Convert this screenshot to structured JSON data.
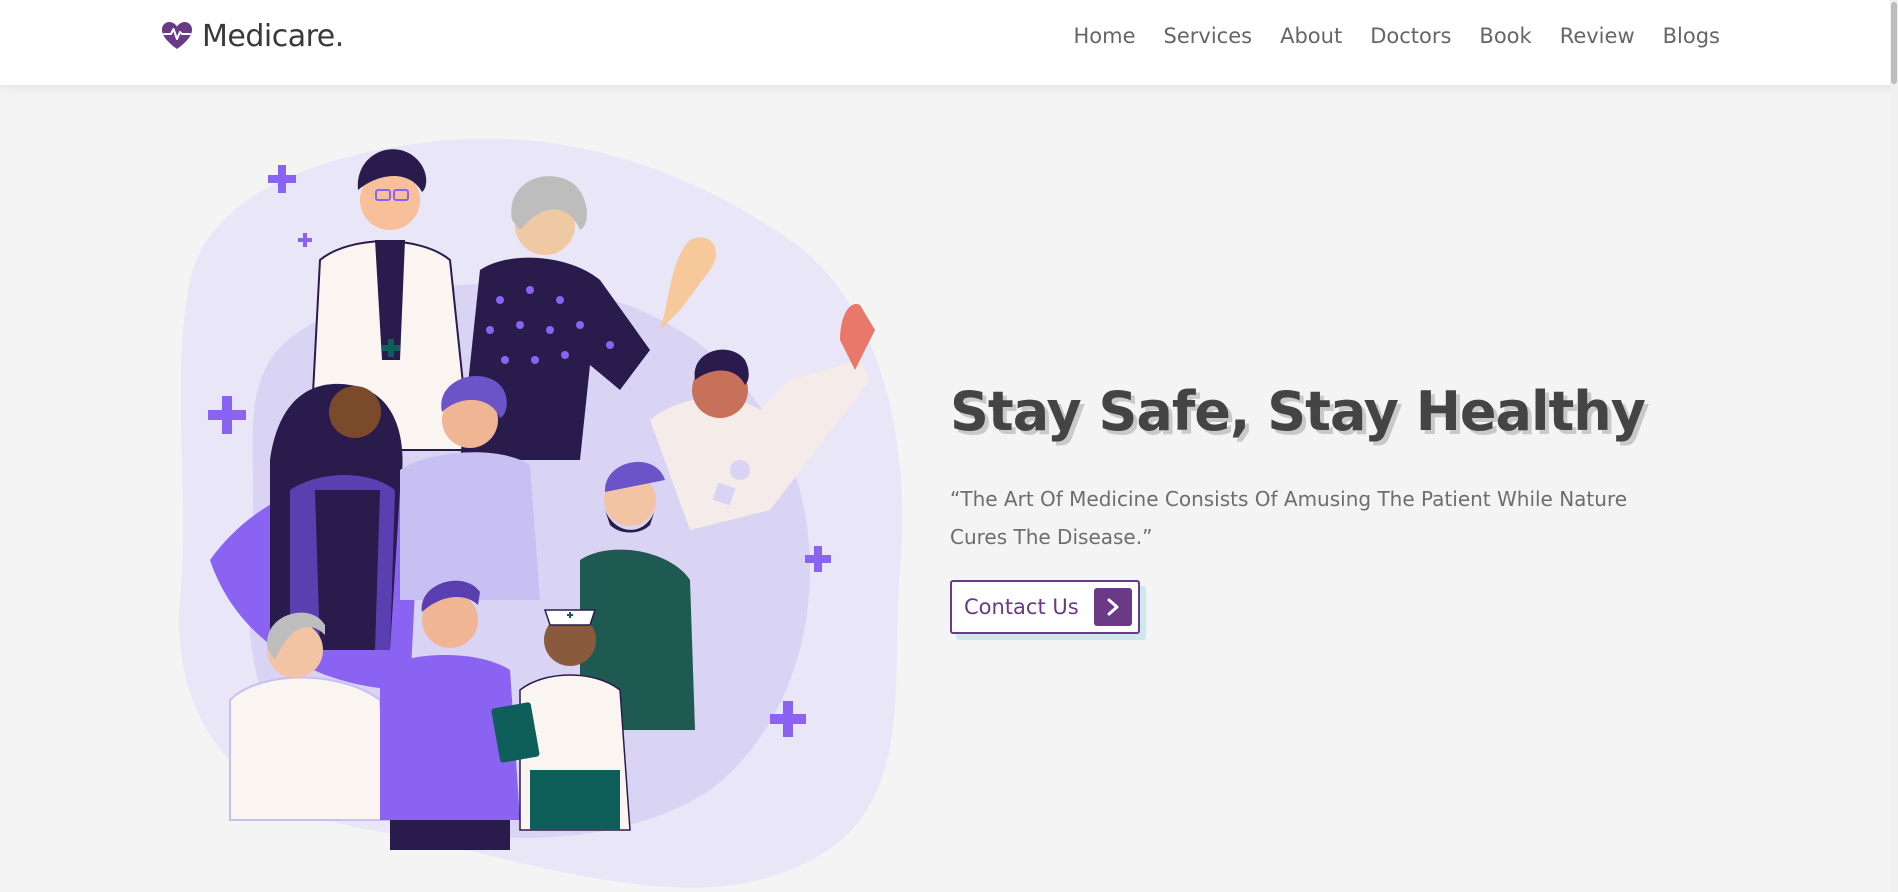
{
  "brand": {
    "name": "Medicare.",
    "accent_color": "#6a3a86",
    "logo_icon": "heart-pulse-icon"
  },
  "nav": {
    "items": [
      {
        "label": "Home"
      },
      {
        "label": "Services"
      },
      {
        "label": "About"
      },
      {
        "label": "Doctors"
      },
      {
        "label": "Book"
      },
      {
        "label": "Review"
      },
      {
        "label": "Blogs"
      }
    ]
  },
  "hero": {
    "title": "Stay Safe, Stay Healthy",
    "quote": "“The Art Of Medicine Consists Of Amusing The Patient While Nature Cures The Disease.”",
    "cta_label": "Contact Us",
    "cta_icon": "chevron-right-icon",
    "illustration": "group-of-people-illustration"
  }
}
